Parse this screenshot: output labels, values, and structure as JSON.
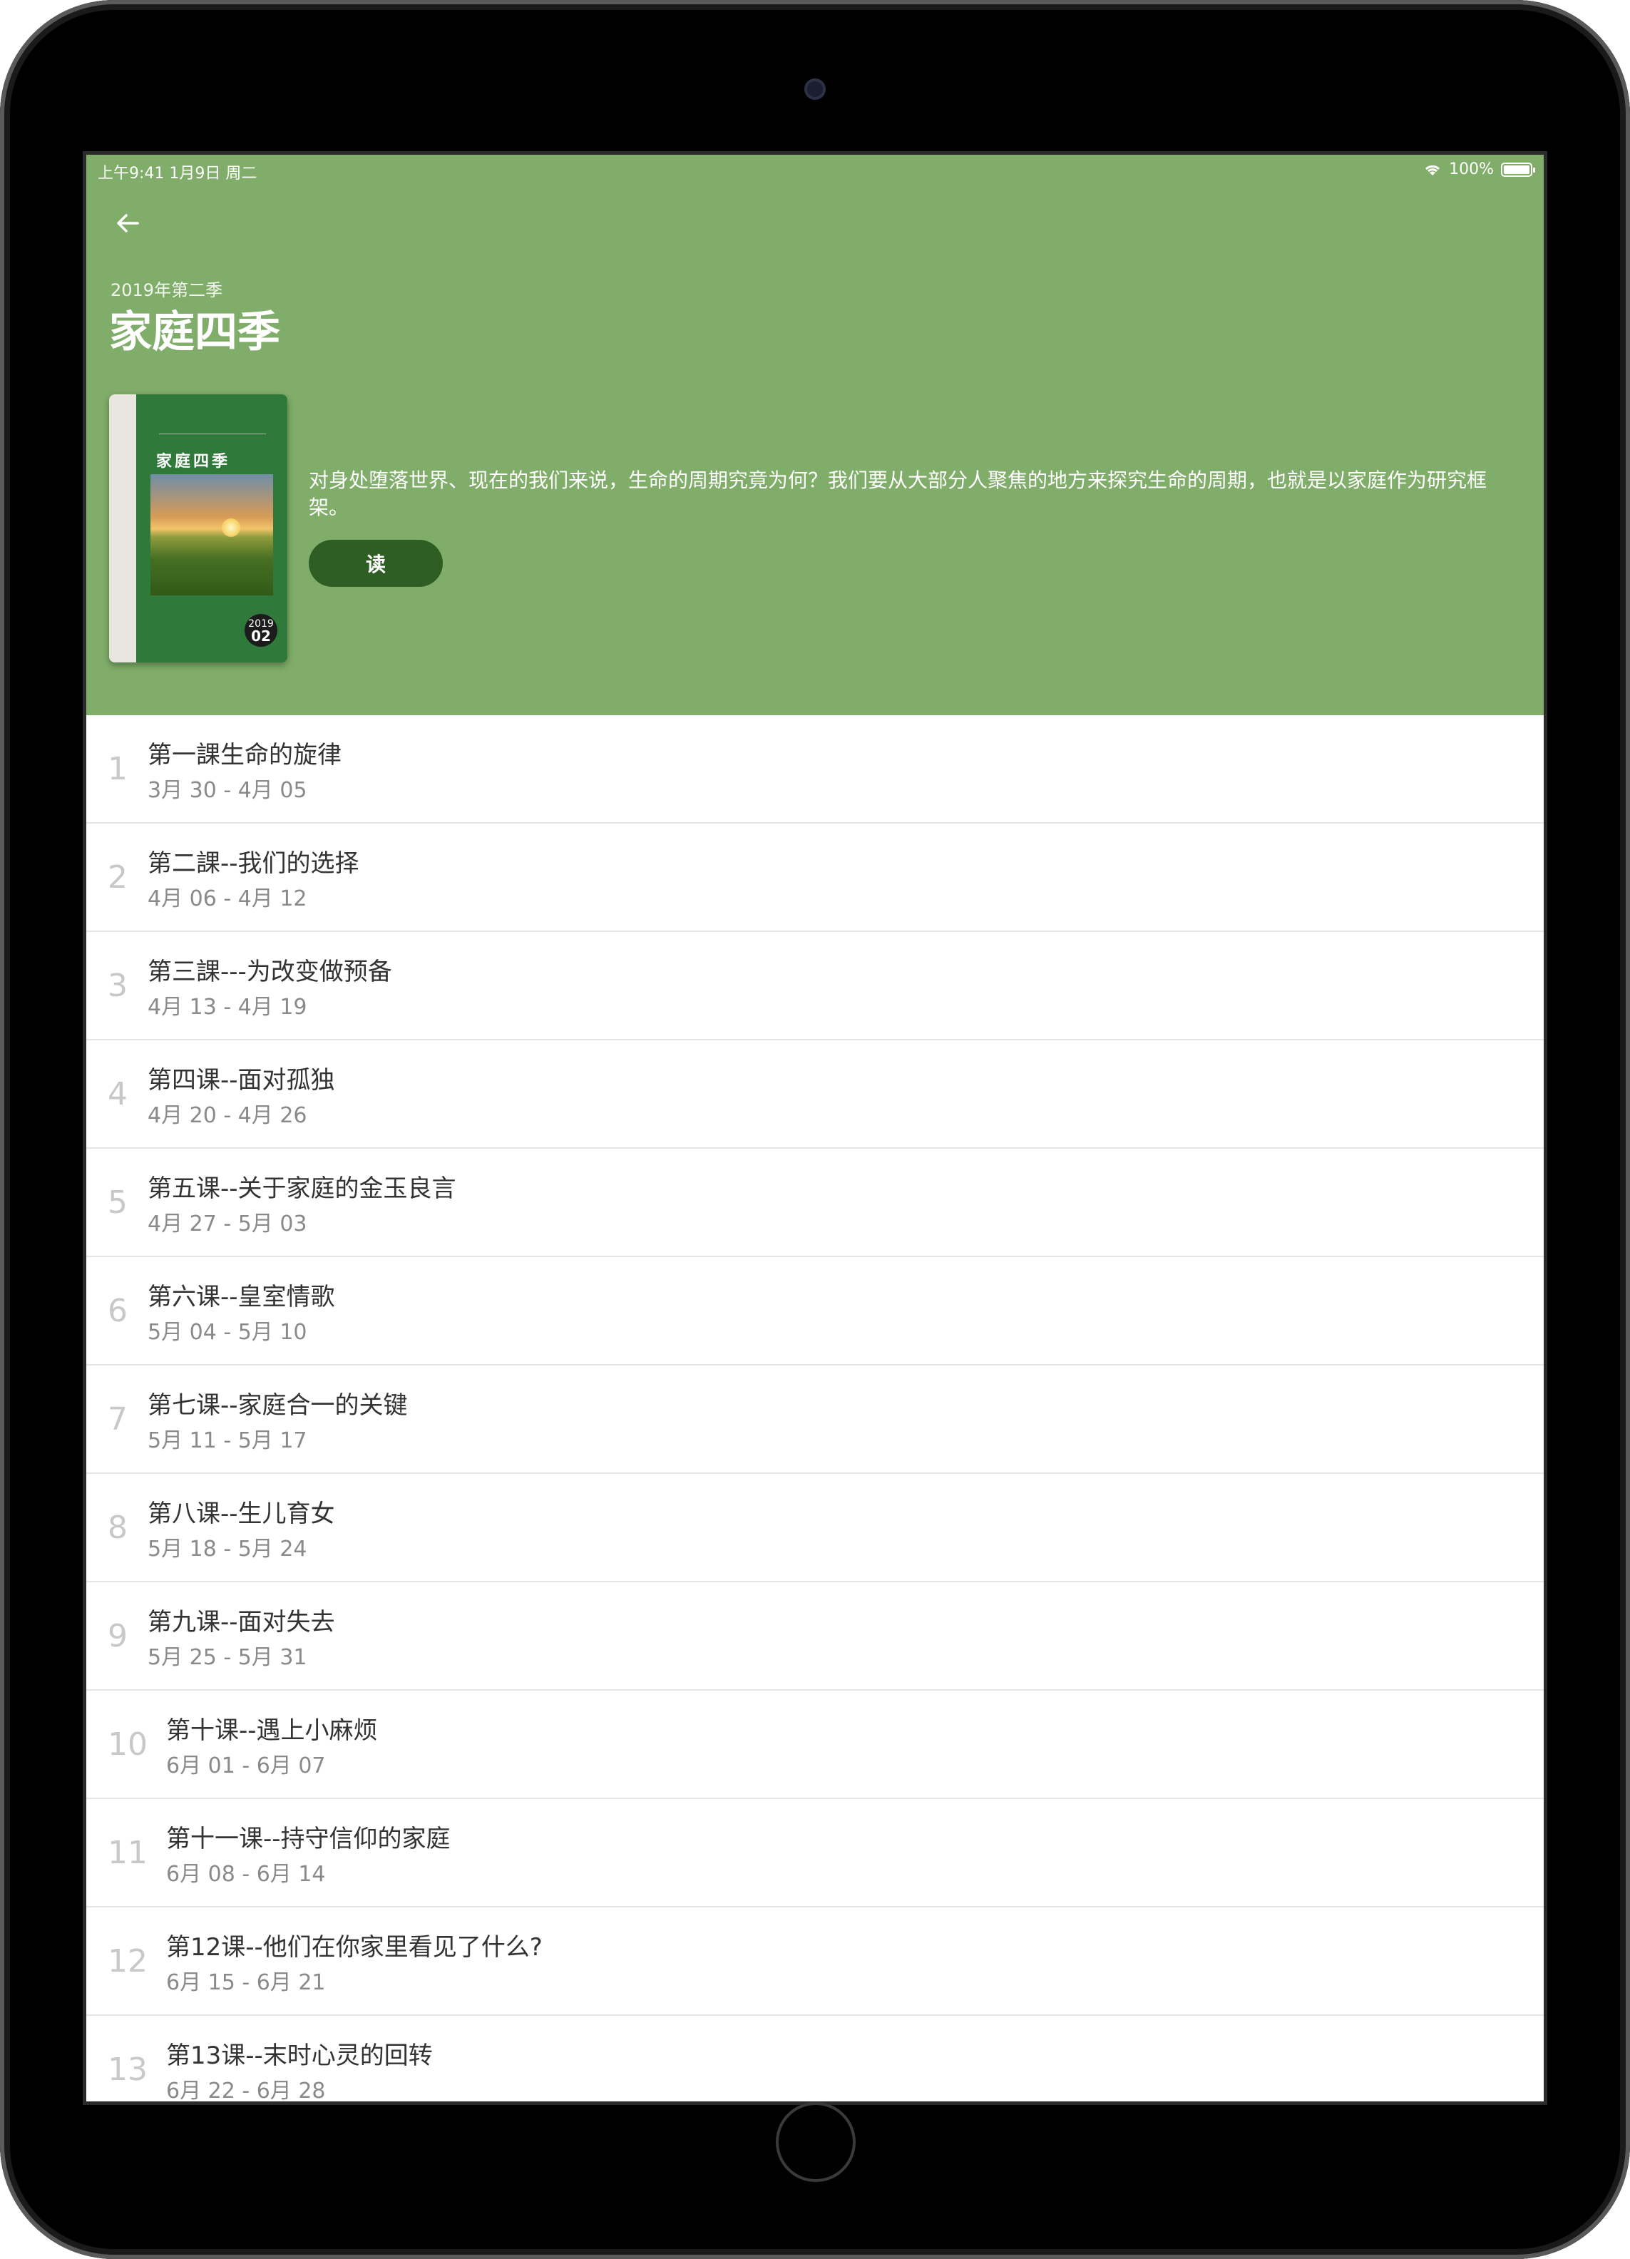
{
  "status_bar": {
    "time_date": "上午9:41   1月9日 周二",
    "battery": "100%"
  },
  "header": {
    "season_label": "2019年第二季",
    "title": "家庭四季",
    "description": "对身处堕落世界、现在的我们来说，生命的周期究竟为何？我们要从大部分人聚焦的地方来探究生命的周期，也就是以家庭作为研究框架。",
    "read_button": "读",
    "background_color": "#80ae6a",
    "button_color": "#2e5e24"
  },
  "cover": {
    "title": "家庭四季",
    "year": "2019",
    "quarter": "02"
  },
  "lessons": [
    {
      "num": "1",
      "title": "第一課生命的旋律",
      "date": "3月 30 - 4月 05"
    },
    {
      "num": "2",
      "title": "第二課--我们的选择",
      "date": "4月 06 - 4月 12"
    },
    {
      "num": "3",
      "title": "第三課---为改变做预备",
      "date": "4月 13 - 4月 19"
    },
    {
      "num": "4",
      "title": "第四课--面对孤独",
      "date": "4月 20 - 4月 26"
    },
    {
      "num": "5",
      "title": "第五课--关于家庭的金玉良言",
      "date": "4月 27 - 5月 03"
    },
    {
      "num": "6",
      "title": "第六课--皇室情歌",
      "date": "5月 04 - 5月 10"
    },
    {
      "num": "7",
      "title": "第七课--家庭合一的关键",
      "date": "5月 11 - 5月 17"
    },
    {
      "num": "8",
      "title": "第八课--生儿育女",
      "date": "5月 18 - 5月 24"
    },
    {
      "num": "9",
      "title": "第九课--面对失去",
      "date": "5月 25 - 5月 31"
    },
    {
      "num": "10",
      "title": "第十课--遇上小麻烦",
      "date": "6月 01 - 6月 07"
    },
    {
      "num": "11",
      "title": "第十一课--持守信仰的家庭",
      "date": "6月 08 - 6月 14"
    },
    {
      "num": "12",
      "title": "第12课--他们在你家里看见了什么?",
      "date": "6月 15 - 6月 21"
    },
    {
      "num": "13",
      "title": "第13课--末时心灵的回转",
      "date": "6月 22 - 6月 28"
    }
  ]
}
